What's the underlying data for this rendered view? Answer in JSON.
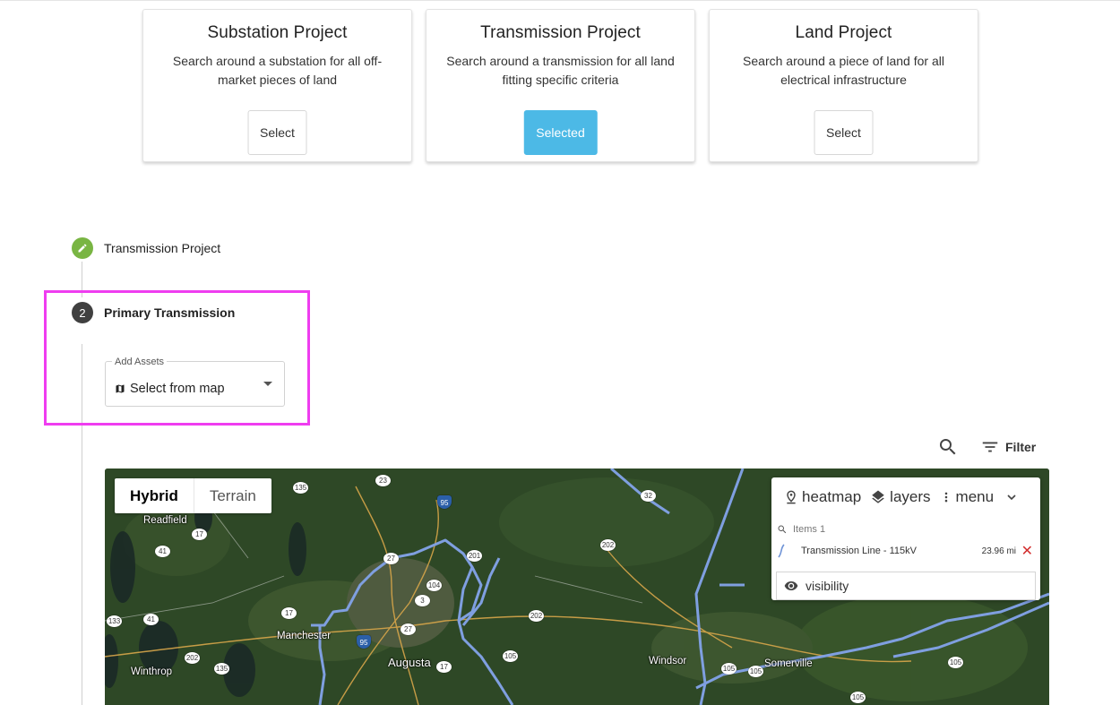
{
  "cards": [
    {
      "title": "Substation Project",
      "description": "Search around a substation for all off-market pieces of land",
      "button": "Select",
      "selected": false
    },
    {
      "title": "Transmission Project",
      "description": "Search around a transmission for all land fitting specific criteria",
      "button": "Selected",
      "selected": true
    },
    {
      "title": "Land Project",
      "description": "Search around a piece of land for all electrical infrastructure",
      "button": "Select",
      "selected": false
    }
  ],
  "stepper": {
    "step1": {
      "label": "Transmission Project",
      "icon": "pencil-icon",
      "color": "#79b543"
    },
    "step2": {
      "number": "2",
      "label": "Primary Transmission",
      "color": "#404040"
    }
  },
  "add_assets": {
    "legend": "Add Assets",
    "value": "Select from map",
    "icon": "map-icon"
  },
  "toolbar": {
    "filter_label": "Filter",
    "search_icon": "search-icon",
    "filter_icon": "filter-icon"
  },
  "map": {
    "types": [
      "Hybrid",
      "Terrain"
    ],
    "active_type": "Hybrid",
    "places": [
      "Readfield",
      "Manchester",
      "Augusta",
      "Winthrop",
      "Windsor",
      "Somerville"
    ],
    "shields": [
      "135",
      "23",
      "95",
      "32",
      "17",
      "41",
      "27",
      "201",
      "202",
      "104",
      "3",
      "17",
      "27",
      "202",
      "133",
      "41",
      "95",
      "105",
      "17",
      "202",
      "135",
      "105",
      "105",
      "105",
      "105"
    ],
    "panel": {
      "heatmap": "heatmap",
      "layers": "layers",
      "menu": "menu",
      "items_label": "Items 1",
      "item_name": "Transmission Line - 115kV",
      "item_distance": "23.96 mi",
      "visibility": "visibility"
    }
  },
  "colors": {
    "accent": "#4cb9e6",
    "highlight": "#ef3df0",
    "line": "#7f9fe0"
  }
}
